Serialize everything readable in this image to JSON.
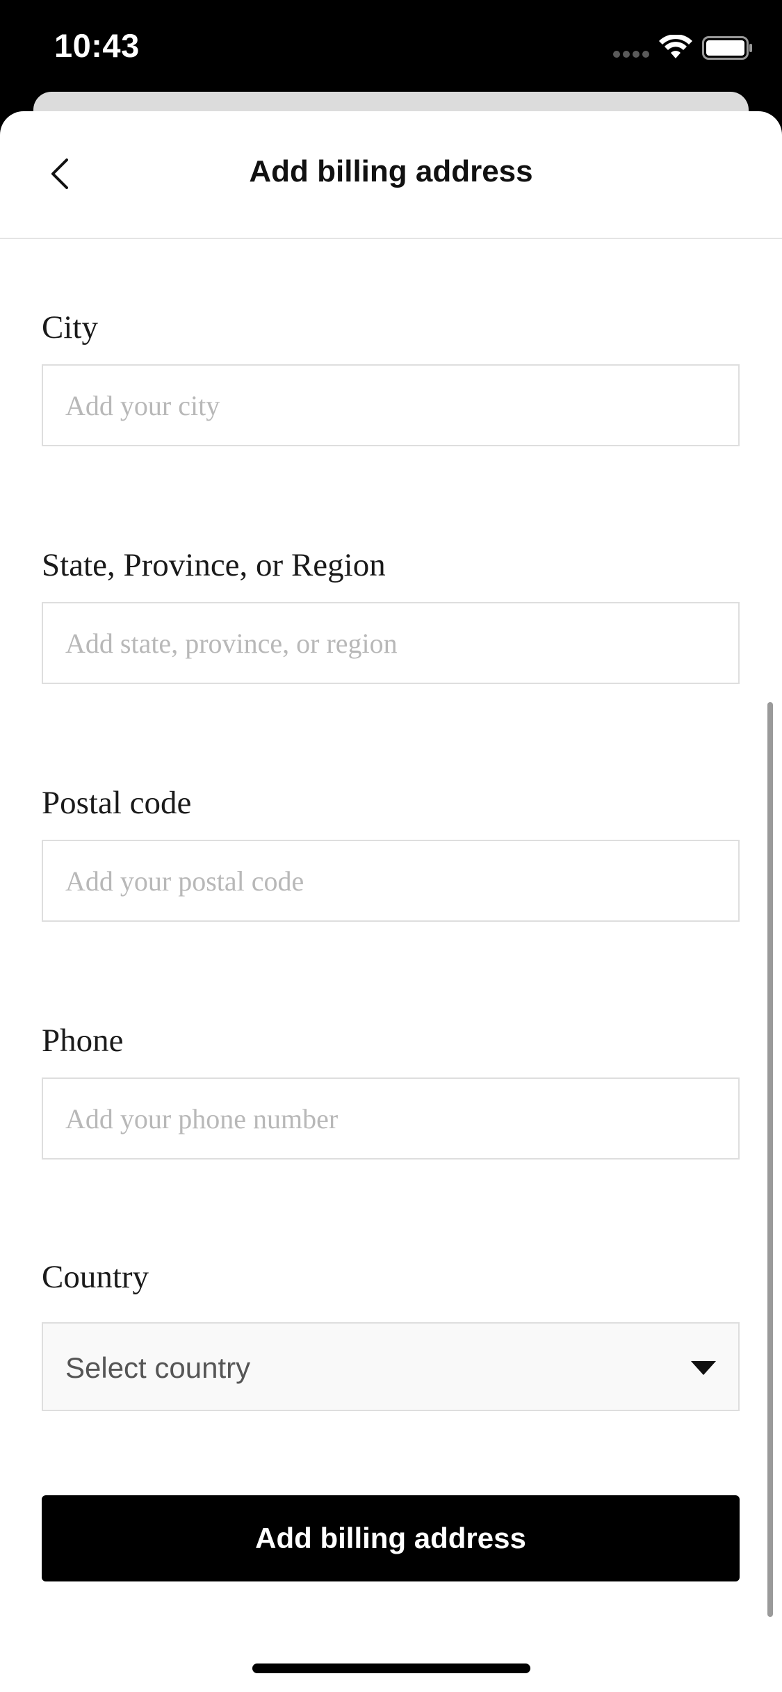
{
  "status_bar": {
    "time": "10:43"
  },
  "header": {
    "title": "Add billing address",
    "back_icon": "chevron-left-icon"
  },
  "form": {
    "city": {
      "label": "City",
      "placeholder": "Add your city",
      "value": ""
    },
    "state": {
      "label": "State, Province, or Region",
      "placeholder": "Add state, province, or region",
      "value": ""
    },
    "postal_code": {
      "label": "Postal code",
      "placeholder": "Add your postal code",
      "value": ""
    },
    "phone": {
      "label": "Phone",
      "placeholder": "Add your phone number",
      "value": ""
    },
    "country": {
      "label": "Country",
      "selected": "Select country",
      "icon": "caret-down-icon"
    },
    "submit_label": "Add billing address"
  },
  "colors": {
    "primary_button": "#000000",
    "input_border": "#dedede",
    "placeholder": "#b8b8b8"
  }
}
